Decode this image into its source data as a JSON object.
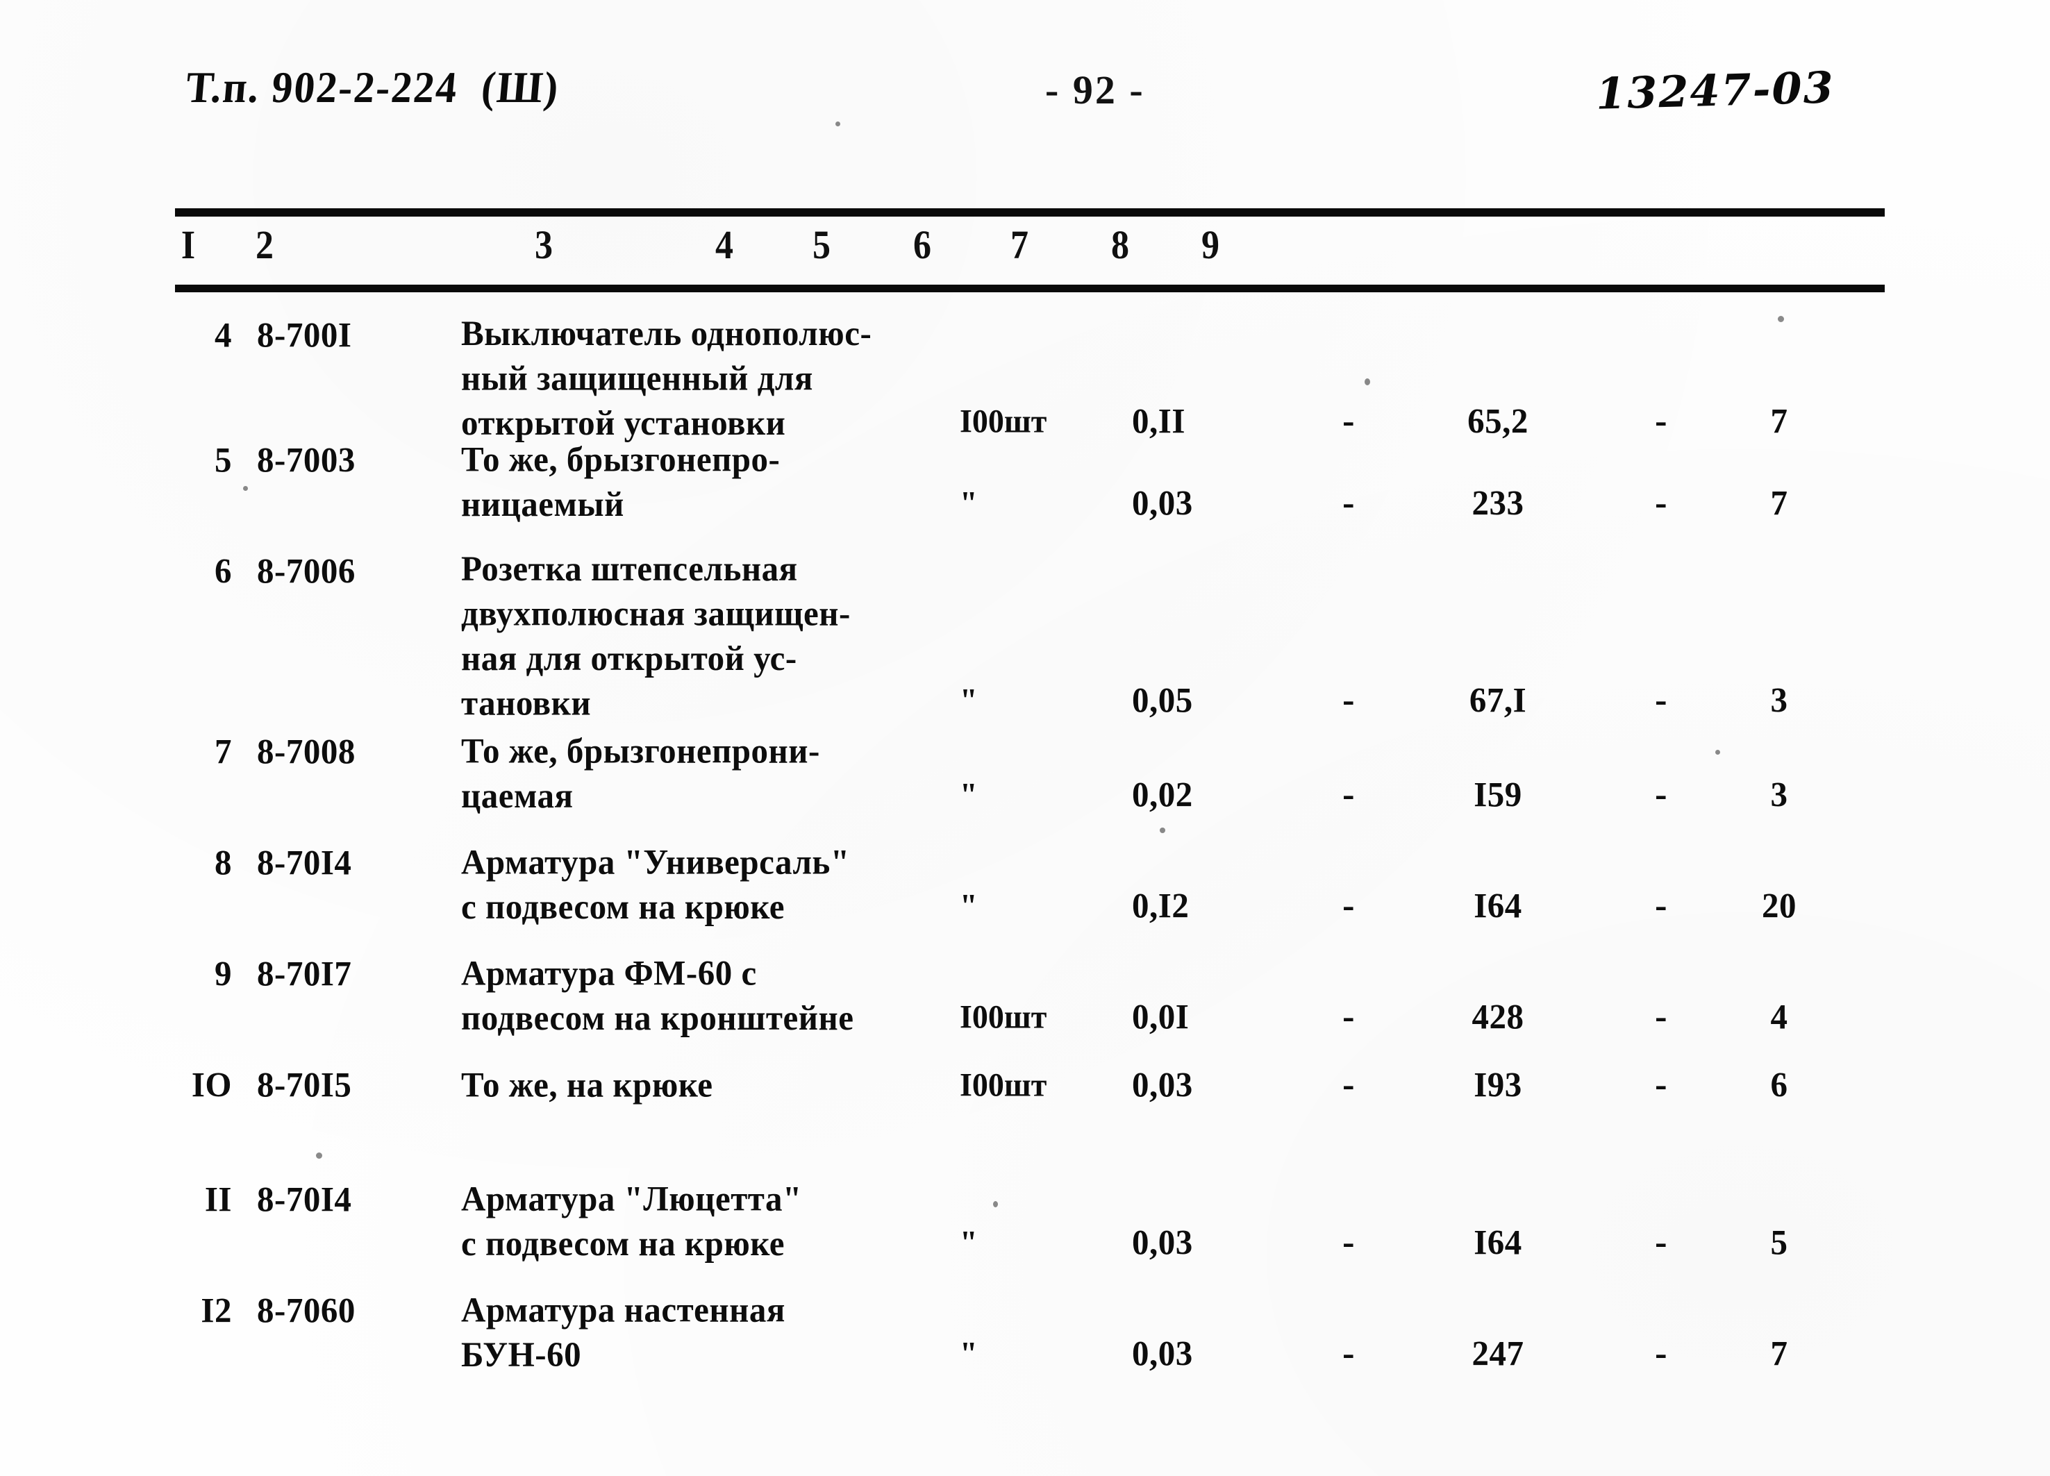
{
  "header": {
    "doc_code": "Т.п. 902-2-224  (Ш)",
    "page_number": "- 92 -",
    "stamp": "13247-03"
  },
  "table": {
    "column_headers": [
      "I",
      "2",
      "3",
      "4",
      "5",
      "6",
      "7",
      "8",
      "9"
    ],
    "rows": [
      {
        "no": "4",
        "code": "8-700I",
        "name": "Выключатель однополюс-\nный защищенный для\nоткрытой установки",
        "unit": "I00шт",
        "qty": "0,II",
        "col6": "-",
        "col7": "65,2",
        "col8": "-",
        "col9": "7"
      },
      {
        "no": "5",
        "code": "8-7003",
        "name": "То же, брызгонепро-\nницаемый",
        "unit": "\"",
        "qty": "0,03",
        "col6": "-",
        "col7": "233",
        "col8": "-",
        "col9": "7"
      },
      {
        "no": "6",
        "code": "8-7006",
        "name": "Розетка штепсельная\nдвухполюсная защищен-\nная для открытой ус-\nтановки",
        "unit": "\"",
        "qty": "0,05",
        "col6": "-",
        "col7": "67,I",
        "col8": "-",
        "col9": "3"
      },
      {
        "no": "7",
        "code": "8-7008",
        "name": "То же, брызгонепрони-\nцаемая",
        "unit": "\"",
        "qty": "0,02",
        "col6": "-",
        "col7": "I59",
        "col8": "-",
        "col9": "3"
      },
      {
        "no": "8",
        "code": "8-70I4",
        "name": "Арматура \"Универсаль\"\nс подвесом на крюке",
        "unit": "\"",
        "qty": "0,I2",
        "col6": "-",
        "col7": "I64",
        "col8": "-",
        "col9": "20"
      },
      {
        "no": "9",
        "code": "8-70I7",
        "name": "Арматура ФМ-60 с\nподвесом на кронштейне",
        "unit": "I00шт",
        "qty": "0,0I",
        "col6": "-",
        "col7": "428",
        "col8": "-",
        "col9": "4"
      },
      {
        "no": "IO",
        "code": "8-70I5",
        "name": "То же, на крюке",
        "unit": "I00шт",
        "qty": "0,03",
        "col6": "-",
        "col7": "I93",
        "col8": "-",
        "col9": "6"
      },
      {
        "no": "II",
        "code": "8-70I4",
        "name": "Арматура \"Люцетта\"\nс подвесом на крюке",
        "unit": "\"",
        "qty": "0,03",
        "col6": "-",
        "col7": "I64",
        "col8": "-",
        "col9": "5"
      },
      {
        "no": "I2",
        "code": "8-7060",
        "name": "Арматура настенная\nБУН-60",
        "unit": "\"",
        "qty": "0,03",
        "col6": "-",
        "col7": "247",
        "col8": "-",
        "col9": "7"
      }
    ]
  },
  "layout": {
    "column_header_x": [
      18,
      128,
      530,
      790,
      930,
      1075,
      1215,
      1360,
      1490
    ],
    "row_tops": [
      0,
      180,
      340,
      600,
      760,
      920,
      1080,
      1245,
      1405
    ],
    "value_line_offsets": [
      124,
      62,
      186,
      62,
      62,
      62,
      0,
      62,
      62
    ]
  },
  "colors": {
    "ink": "#0d0d0d",
    "paper": "#fefefe"
  }
}
